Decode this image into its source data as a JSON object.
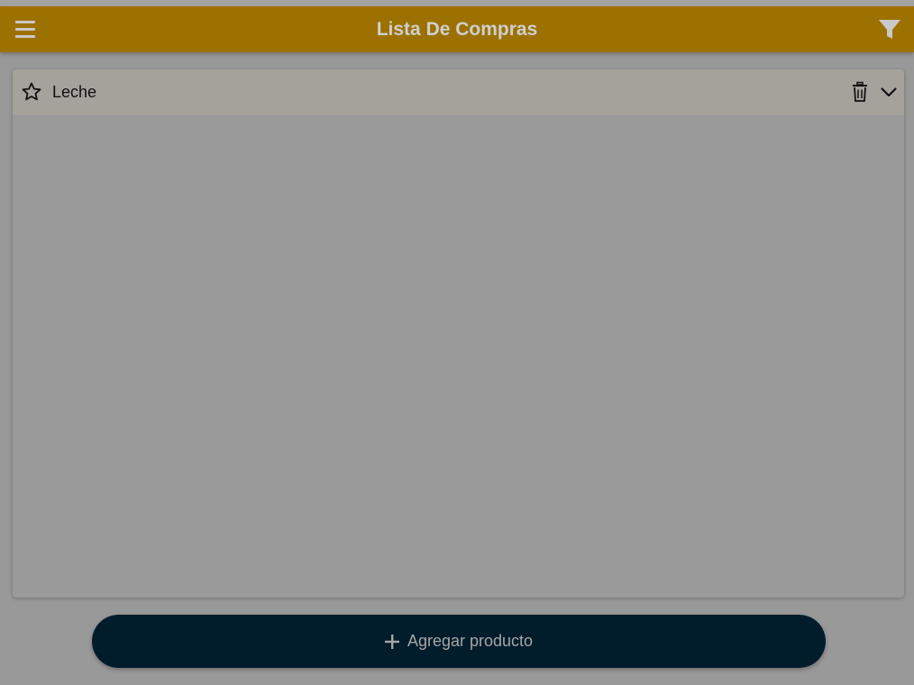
{
  "app": {
    "title": "Lista De Compras",
    "accent_color": "#9c7100",
    "icons": {
      "menu": "hamburger-menu-icon",
      "filter": "filter-funnel-icon"
    }
  },
  "list": {
    "items": [
      {
        "name": "Leche",
        "favorite": false,
        "icons": [
          "star-outline-icon",
          "trash-icon",
          "chevron-down-icon"
        ]
      }
    ]
  },
  "footer": {
    "add_button_label": "Agregar producto",
    "add_button_color": "#011c2b",
    "icon": "plus-icon"
  }
}
